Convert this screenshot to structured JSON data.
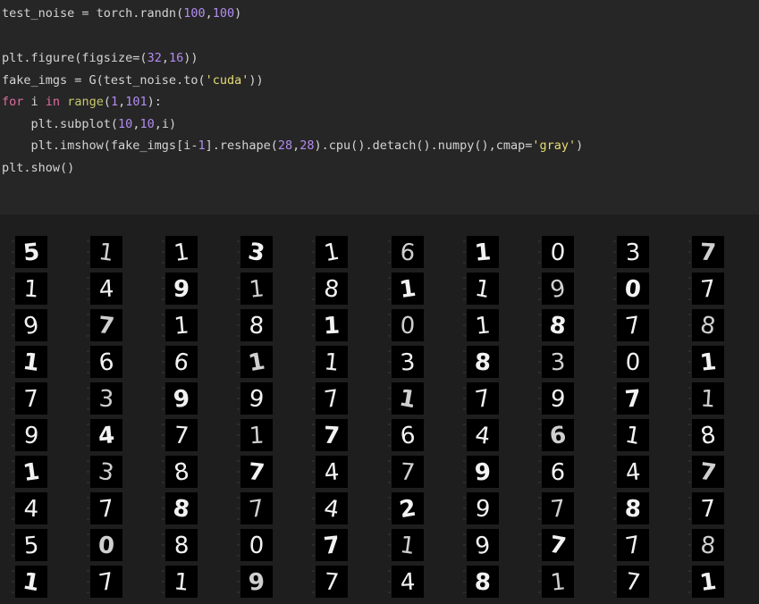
{
  "colors": {
    "code_bg": "#262626",
    "output_bg": "#1e1e1e",
    "default": "#d4d4d4",
    "keyword": "#e06c9f",
    "number": "#b38cf0",
    "string": "#e6db74",
    "builtin": "#c8c86c"
  },
  "code_lines": [
    [
      {
        "t": "test_noise = torch.randn(",
        "c": "default"
      },
      {
        "t": "100",
        "c": "number"
      },
      {
        "t": ",",
        "c": "default"
      },
      {
        "t": "100",
        "c": "number"
      },
      {
        "t": ")",
        "c": "default"
      }
    ],
    [],
    [
      {
        "t": "plt.figure(figsize=(",
        "c": "default"
      },
      {
        "t": "32",
        "c": "number"
      },
      {
        "t": ",",
        "c": "default"
      },
      {
        "t": "16",
        "c": "number"
      },
      {
        "t": "))",
        "c": "default"
      }
    ],
    [
      {
        "t": "fake_imgs = G(test_noise.to(",
        "c": "default"
      },
      {
        "t": "'cuda'",
        "c": "string"
      },
      {
        "t": "))",
        "c": "default"
      }
    ],
    [
      {
        "t": "for",
        "c": "keyword"
      },
      {
        "t": " i ",
        "c": "default"
      },
      {
        "t": "in",
        "c": "keyword"
      },
      {
        "t": " ",
        "c": "default"
      },
      {
        "t": "range",
        "c": "builtin"
      },
      {
        "t": "(",
        "c": "default"
      },
      {
        "t": "1",
        "c": "number"
      },
      {
        "t": ",",
        "c": "default"
      },
      {
        "t": "101",
        "c": "number"
      },
      {
        "t": "):",
        "c": "default"
      }
    ],
    [
      {
        "t": "    plt.subplot(",
        "c": "default"
      },
      {
        "t": "10",
        "c": "number"
      },
      {
        "t": ",",
        "c": "default"
      },
      {
        "t": "10",
        "c": "number"
      },
      {
        "t": ",i)",
        "c": "default"
      }
    ],
    [
      {
        "t": "    plt.imshow(fake_imgs[i-",
        "c": "default"
      },
      {
        "t": "1",
        "c": "number"
      },
      {
        "t": "].reshape(",
        "c": "default"
      },
      {
        "t": "28",
        "c": "number"
      },
      {
        "t": ",",
        "c": "default"
      },
      {
        "t": "28",
        "c": "number"
      },
      {
        "t": ").cpu().detach().numpy(),cmap=",
        "c": "default"
      },
      {
        "t": "'gray'",
        "c": "string"
      },
      {
        "t": ")",
        "c": "default"
      }
    ],
    [
      {
        "t": "plt.show()",
        "c": "default"
      }
    ]
  ],
  "digit_grid": {
    "rows": 10,
    "cols": 10,
    "cells": [
      "5",
      "1",
      "1",
      "3",
      "1",
      "6",
      "1",
      "0",
      "3",
      "7",
      "1",
      "4",
      "9",
      "1",
      "8",
      "1",
      "1",
      "9",
      "0",
      "7",
      "9",
      "7",
      "1",
      "8",
      "1",
      "0",
      "1",
      "8",
      "7",
      "8",
      "1",
      "6",
      "6",
      "1",
      "1",
      "3",
      "8",
      "3",
      "0",
      "1",
      "7",
      "3",
      "9",
      "9",
      "7",
      "1",
      "7",
      "9",
      "7",
      "1",
      "9",
      "4",
      "7",
      "1",
      "7",
      "6",
      "4",
      "6",
      "1",
      "8",
      "1",
      "3",
      "8",
      "7",
      "4",
      "7",
      "9",
      "6",
      "4",
      "7",
      "4",
      "7",
      "8",
      "7",
      "4",
      "2",
      "9",
      "7",
      "8",
      "7",
      "5",
      "0",
      "8",
      "0",
      "7",
      "1",
      "9",
      "7",
      "7",
      "8",
      "1",
      "7",
      "1",
      "9",
      "7",
      "4",
      "8",
      "1",
      "7",
      "1"
    ]
  }
}
